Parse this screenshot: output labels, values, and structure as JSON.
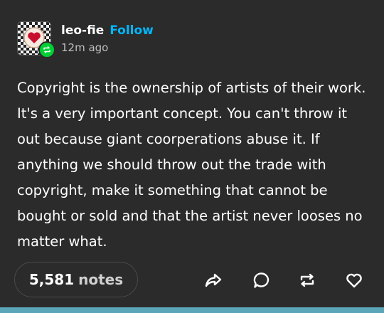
{
  "post": {
    "username": "leo-fie",
    "follow_label": "Follow",
    "timestamp": "12m ago",
    "body": "Copyright is the ownership of artists of their work. It's a very important concept. You can't throw it out because giant coorperations abuse it. If anything we should throw out the trade with copyright, make it something that cannot be bought or sold and that the artist never looses no matter what.",
    "notes_count": "5,581",
    "notes_label": "notes"
  },
  "colors": {
    "background": "#2b2b2b",
    "follow_accent": "#00b8ff",
    "reblog_badge": "#00cf35",
    "bottom_bar": "#5aa6b8"
  },
  "icons": {
    "avatar": "checkered-heart-avatar",
    "badge": "reblog-icon",
    "actions": [
      "share-icon",
      "reply-icon",
      "reblog-icon",
      "like-icon"
    ]
  }
}
